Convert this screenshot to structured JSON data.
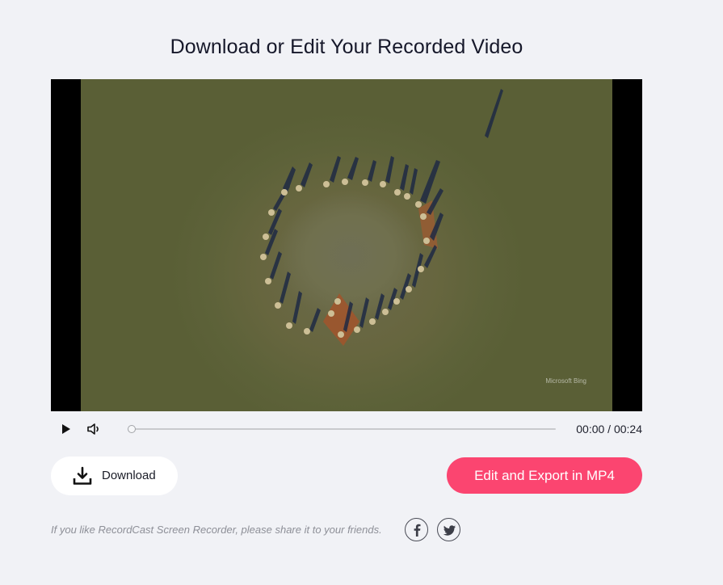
{
  "page": {
    "title": "Download or Edit Your Recorded Video"
  },
  "video": {
    "watermark": "Microsoft Bing",
    "progress": 0
  },
  "player": {
    "play_icon": "play-icon",
    "volume_icon": "volume-icon",
    "time_display": "00:00 / 00:24"
  },
  "actions": {
    "download_label": "Download",
    "download_icon": "download-icon",
    "export_label": "Edit and Export in MP4",
    "export_color": "#fb4570"
  },
  "share": {
    "text": "If you like RecordCast Screen Recorder, please share it to your friends.",
    "facebook_icon": "facebook-icon",
    "twitter_icon": "twitter-icon"
  }
}
